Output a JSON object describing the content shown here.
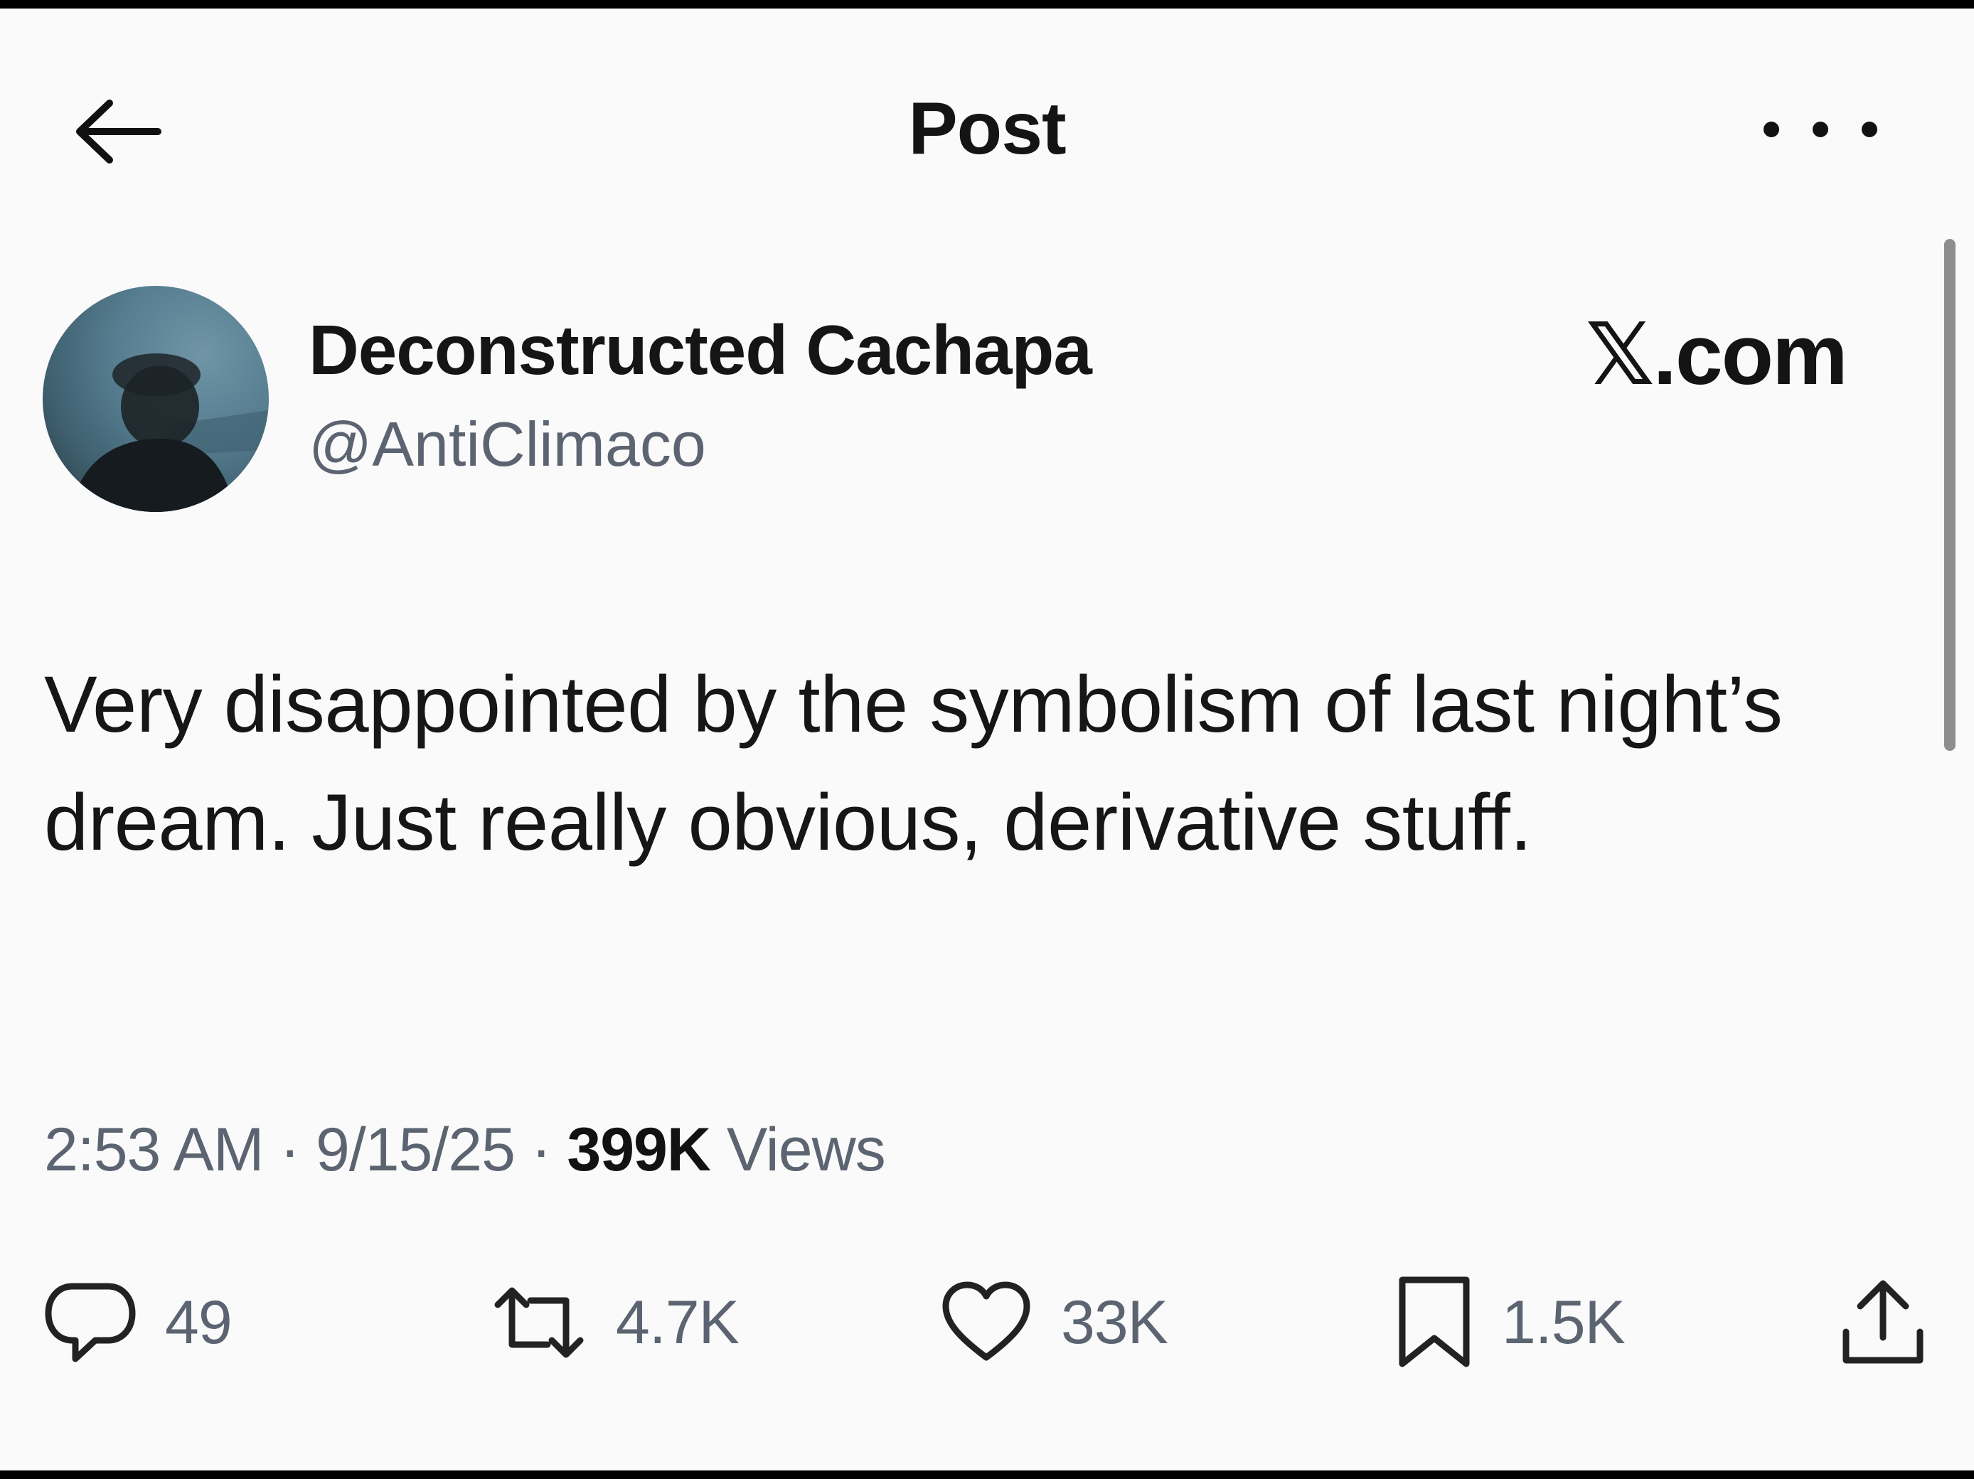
{
  "header": {
    "title": "Post",
    "back_icon": "arrow-left-icon",
    "more_icon": "more-horizontal-icon"
  },
  "author": {
    "name": "Deconstructed Cachapa",
    "handle": "@AntiClimaco",
    "avatar_icon": "avatar"
  },
  "watermark": "𝕏.com",
  "post": {
    "text": "Very disappointed by the symbolism of last night’s dream. Just really obvious, derivative stuff."
  },
  "meta": {
    "time": "2:53 AM",
    "date": "9/15/25",
    "separator": "·",
    "views_count": "399K",
    "views_label": "Views"
  },
  "actions": {
    "replies": "49",
    "reposts": "4.7K",
    "likes": "33K",
    "bookmarks": "1.5K"
  },
  "colors": {
    "background": "#fafafa",
    "text": "#111111",
    "secondary_text": "#5b6470"
  }
}
